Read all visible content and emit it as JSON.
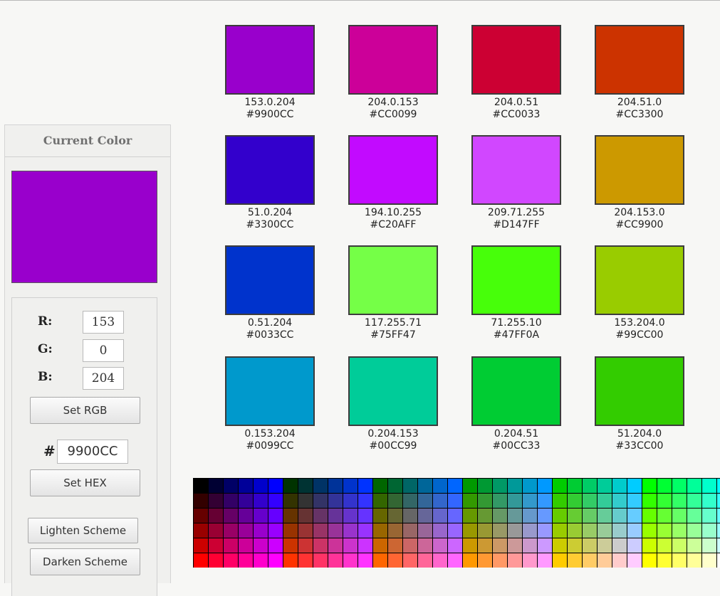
{
  "panel": {
    "title": "Current Color",
    "current_color": "#9900CC",
    "r_label": "R:",
    "g_label": "G:",
    "b_label": "B:",
    "r_value": "153",
    "g_value": "0",
    "b_value": "204",
    "set_rgb_label": "Set RGB",
    "hash_label": "#",
    "hex_value": "9900CC",
    "set_hex_label": "Set HEX",
    "lighten_label": "Lighten Scheme",
    "darken_label": "Darken Scheme"
  },
  "swatches": [
    {
      "rgb": "153.0.204",
      "hex": "#9900CC"
    },
    {
      "rgb": "204.0.153",
      "hex": "#CC0099"
    },
    {
      "rgb": "204.0.51",
      "hex": "#CC0033"
    },
    {
      "rgb": "204.51.0",
      "hex": "#CC3300"
    },
    {
      "rgb": "51.0.204",
      "hex": "#3300CC"
    },
    {
      "rgb": "194.10.255",
      "hex": "#C20AFF"
    },
    {
      "rgb": "209.71.255",
      "hex": "#D147FF"
    },
    {
      "rgb": "204.153.0",
      "hex": "#CC9900"
    },
    {
      "rgb": "0.51.204",
      "hex": "#0033CC"
    },
    {
      "rgb": "117.255.71",
      "hex": "#75FF47"
    },
    {
      "rgb": "71.255.10",
      "hex": "#47FF0A"
    },
    {
      "rgb": "153.204.0",
      "hex": "#99CC00"
    },
    {
      "rgb": "0.153.204",
      "hex": "#0099CC"
    },
    {
      "rgb": "0.204.153",
      "hex": "#00CC99"
    },
    {
      "rgb": "0.204.51",
      "hex": "#00CC33"
    },
    {
      "rgb": "51.204.0",
      "hex": "#33CC00"
    }
  ]
}
